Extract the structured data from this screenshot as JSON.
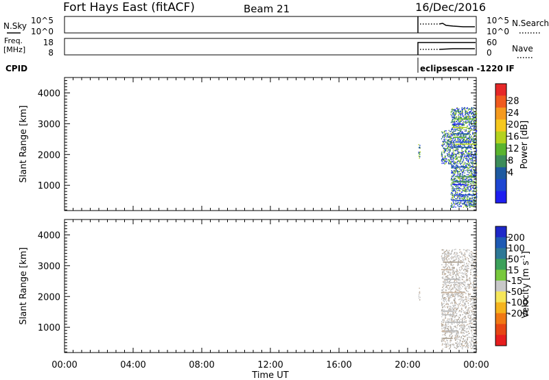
{
  "header": {
    "station": "Fort Hays East (fitACF)",
    "beam": "Beam 21",
    "date": "16/Dec/2016"
  },
  "noise_panel": {
    "left_label": "N.Sky",
    "left_ticks": [
      "10^5",
      "10^0"
    ],
    "right_ticks": [
      "10^5",
      "10^0"
    ],
    "right_label": "N.Search"
  },
  "freq_panel": {
    "left_label_top": "Freq.",
    "left_label_bottom": "[MHz]",
    "left_ticks": [
      "18",
      "8"
    ],
    "right_ticks": [
      "60",
      "0"
    ],
    "right_label": "Nave"
  },
  "cpid": {
    "label": "CPID",
    "mode_text": "eclipsescan -1220 IF"
  },
  "x_axis": {
    "label": "Time UT",
    "tick_labels": [
      "00:00",
      "04:00",
      "08:00",
      "12:00",
      "16:00",
      "20:00",
      "00:00"
    ]
  },
  "power_colorbar": {
    "label": "Power [dB]",
    "tick_labels": [
      "28",
      "24",
      "20",
      "16",
      "12",
      "8",
      "4"
    ],
    "colors": [
      "#e62828",
      "#f05a1e",
      "#f59a1e",
      "#f5c81e",
      "#b4d21e",
      "#5ab42d",
      "#3c8c5a",
      "#1e5aa0",
      "#1e46d2",
      "#1e1ef0"
    ]
  },
  "velocity_colorbar": {
    "label": "Velocity [m s^-1]",
    "tick_labels": [
      "200",
      "100",
      "50",
      "15",
      "-15",
      "-50",
      "-100",
      "-200"
    ],
    "colors": [
      "#1e28c8",
      "#1e5ab4",
      "#2d7896",
      "#3ca05a",
      "#78c83c",
      "#c8c8c8",
      "#f5e65a",
      "#f5b41e",
      "#f07814",
      "#e64614",
      "#e61e1e"
    ]
  },
  "chart_data": [
    {
      "type": "heatmap",
      "title": "Power",
      "xlabel": "Time UT",
      "ylabel": "Slant Range [km]",
      "xlim": [
        0,
        24
      ],
      "ylim": [
        180,
        4500
      ],
      "yticks": [
        1000,
        2000,
        3000,
        4000
      ],
      "colorbar_label": "Power [dB]",
      "colorbar_range": [
        0,
        32
      ],
      "scatter_segments": [
        {
          "t_start": 20.6,
          "t_end": 20.7,
          "range_min": 1850,
          "range_max": 2400,
          "value": 14
        },
        {
          "t_start": 21.95,
          "t_end": 22.5,
          "range_min": 1700,
          "range_max": 2800,
          "value": 14
        },
        {
          "t_start": 22.5,
          "t_end": 24.0,
          "range_min": 300,
          "range_max": 3550,
          "value": 5
        }
      ]
    },
    {
      "type": "heatmap",
      "title": "Velocity",
      "xlabel": "Time UT",
      "ylabel": "Slant Range [km]",
      "xlim": [
        0,
        24
      ],
      "ylim": [
        180,
        4500
      ],
      "yticks": [
        1000,
        2000,
        3000,
        4000
      ],
      "colorbar_label": "Velocity [m s^-1]",
      "colorbar_range": [
        -250,
        250
      ],
      "scatter_segments": [
        {
          "t_start": 20.6,
          "t_end": 20.7,
          "range_min": 1900,
          "range_max": 2350,
          "value": 0
        },
        {
          "t_start": 21.95,
          "t_end": 24.0,
          "range_min": 300,
          "range_max": 3550,
          "value": 0
        }
      ]
    }
  ]
}
